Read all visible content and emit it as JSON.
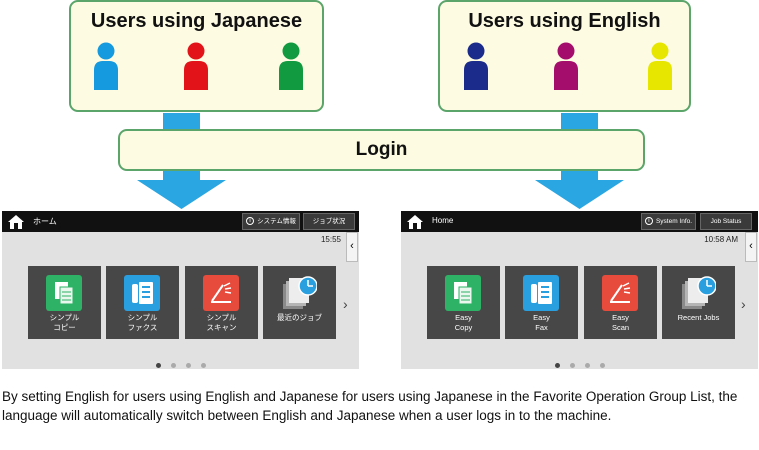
{
  "groups": {
    "japanese": {
      "title": "Users using Japanese",
      "user_colors": [
        "#1599df",
        "#e2141a",
        "#119a3f"
      ]
    },
    "english": {
      "title": "Users using English",
      "user_colors": [
        "#1a2b8c",
        "#a50d6c",
        "#e6e600"
      ]
    }
  },
  "login": {
    "label": "Login"
  },
  "colors": {
    "arrow": "#2aa6e2",
    "box_fill": "#fdfbe1",
    "box_border": "#5ba56a"
  },
  "screens": {
    "japanese": {
      "home_label": "ホーム",
      "system_info": "システム情報",
      "job_status": "ジョブ状況",
      "clock": "15:55",
      "tiles": [
        {
          "label": "シンプル\nコピー",
          "icon": "copy-icon"
        },
        {
          "label": "シンプル\nファクス",
          "icon": "fax-icon"
        },
        {
          "label": "シンプル\nスキャン",
          "icon": "scan-icon"
        },
        {
          "label": "最近のジョブ",
          "icon": "recent-jobs-icon"
        }
      ],
      "page_dots": 4,
      "active_page": 1
    },
    "english": {
      "home_label": "Home",
      "system_info": "System Info.",
      "job_status": "Job Status",
      "clock": "10:58 AM",
      "tiles": [
        {
          "label": "Easy\nCopy",
          "icon": "copy-icon"
        },
        {
          "label": "Easy\nFax",
          "icon": "fax-icon"
        },
        {
          "label": "Easy\nScan",
          "icon": "scan-icon"
        },
        {
          "label": "Recent Jobs",
          "icon": "recent-jobs-icon"
        }
      ],
      "page_dots": 4,
      "active_page": 1
    }
  },
  "caption": "By setting English for users using English and Japanese for users using Japanese in the Favorite Operation Group List, the language will automatically switch between English and Japanese when a user logs in to the machine."
}
